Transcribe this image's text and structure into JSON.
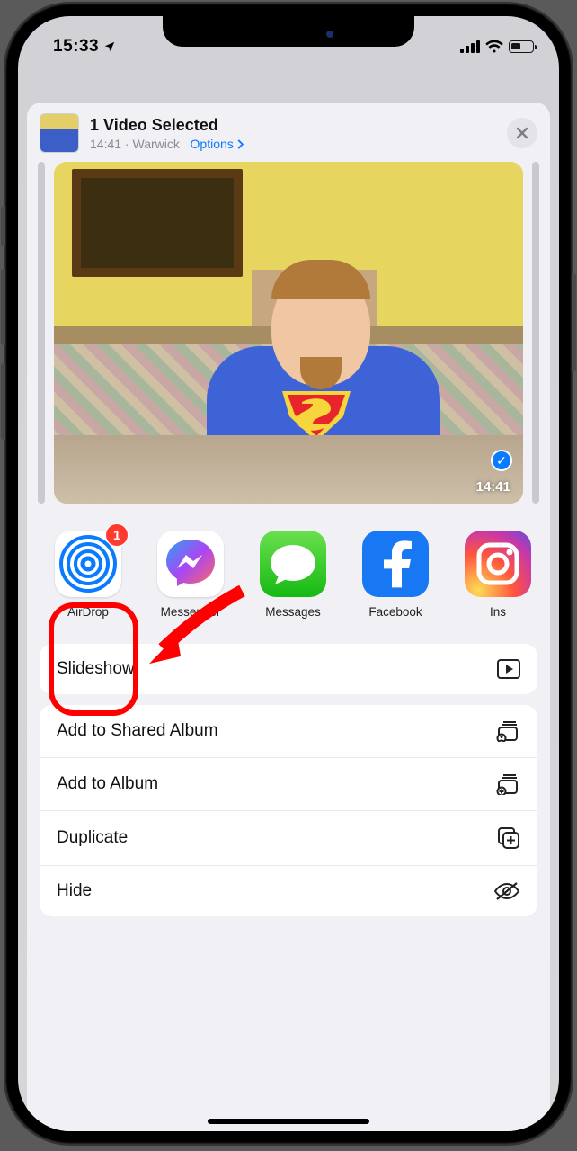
{
  "status": {
    "time": "15:33"
  },
  "header": {
    "title": "1 Video Selected",
    "time": "14:41",
    "sep": "  ·  ",
    "location": "Warwick",
    "options": "Options"
  },
  "preview": {
    "duration": "14:41"
  },
  "apps": [
    {
      "label": "AirDrop",
      "badge": "1"
    },
    {
      "label": "Messenger"
    },
    {
      "label": "Messages"
    },
    {
      "label": "Facebook"
    },
    {
      "label": "Instagram",
      "short": "Ins"
    }
  ],
  "actions_group1": [
    {
      "label": "Slideshow",
      "icon": "play"
    }
  ],
  "actions_group2": [
    {
      "label": "Add to Shared Album",
      "icon": "shared-album"
    },
    {
      "label": "Add to Album",
      "icon": "album-add"
    },
    {
      "label": "Duplicate",
      "icon": "dup"
    },
    {
      "label": "Hide",
      "icon": "eye-slash"
    }
  ]
}
